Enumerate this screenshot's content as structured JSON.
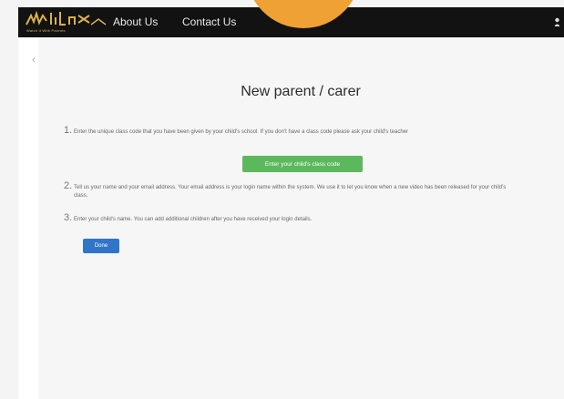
{
  "header": {
    "logo_text": "Watch It With Parents",
    "nav": [
      "About Us",
      "Contact Us"
    ]
  },
  "main": {
    "title": "New parent / carer",
    "steps": [
      {
        "number": "1.",
        "text": "Enter the unique class code that you have been given by your child's school. If you don't have a class code please ask your child's teacher"
      },
      {
        "number": "2.",
        "text": "Tell us your name and your email address. Your email address is your login name within the system. We use it to let you know when a new video has been released for your child's class."
      },
      {
        "number": "3.",
        "text": "Enter your child's name. You can add additional children after you have received your login details."
      }
    ],
    "class_code_button": "Enter your child's class code",
    "done_button": "Done"
  },
  "colors": {
    "topbar": "#121212",
    "accent_orange": "#f0a133",
    "logo_gold": "#d9b24a",
    "green_button": "#5cb85c",
    "blue_button": "#3175c9"
  }
}
